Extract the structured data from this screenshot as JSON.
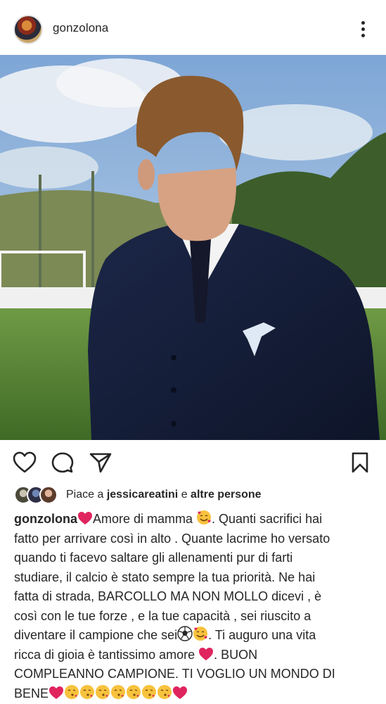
{
  "post": {
    "username": "gonzolona",
    "likes_prefix": "Piace a",
    "liked_by": "jessicareatini",
    "likes_connector": "e",
    "likes_suffix": "altre persone",
    "caption_lines": [
      "Amore di mamma",
      ". Quanti sacrifici hai",
      "fatto per arrivare così in alto . Quante lacrime ho versato",
      "quando ti facevo saltare gli allenamenti pur di farti",
      "studiare, il calcio è stato sempre la tua priorità.  Ne hai",
      "fatta di strada, BARCOLLO MA NON MOLLO dicevi , è",
      "così con le tue forze , e la tue capacità , sei riuscito a",
      "diventare il campione che sei",
      ". Ti auguro una vita",
      "ricca di gioia è tantissimo amore",
      ". BUON",
      "COMPLEANNO CAMPIONE.  TI VOGLIO UN MONDO DI",
      "BENE"
    ]
  },
  "icons": {
    "more": "more-vertical-icon",
    "like": "heart-outline-icon",
    "comment": "comment-bubble-icon",
    "share": "paper-plane-icon",
    "save": "bookmark-icon",
    "emoji_heart": "red-heart-emoji",
    "emoji_smile_hearts": "smiling-face-with-hearts-emoji",
    "emoji_ball": "soccer-ball-emoji",
    "emoji_kiss": "face-blowing-kiss-emoji"
  },
  "colors": {
    "text": "#262626",
    "heart_red": "#e0245e",
    "emoji_yellow": "#f7c23d"
  }
}
